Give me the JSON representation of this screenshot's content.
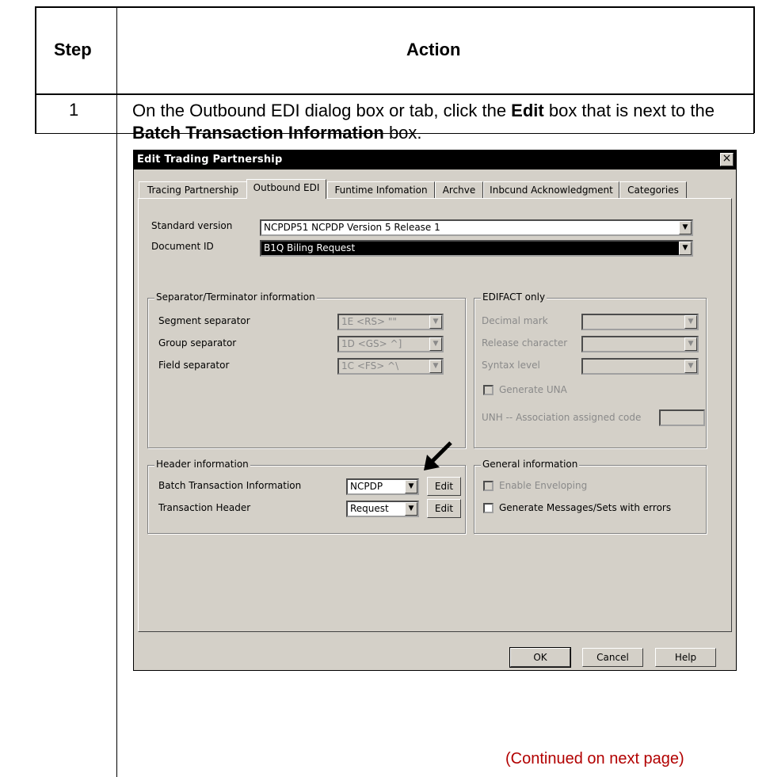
{
  "table": {
    "step_header": "Step",
    "action_header": "Action",
    "step_number": "1",
    "action_parts": [
      "On the Outbound EDI dialog box or tab, click the ",
      "Edit",
      " box that is next to the ",
      "Batch Transaction Information",
      " box."
    ],
    "continued": "(Continued on next page)"
  },
  "dialog": {
    "title": "Edit Trading Partnership",
    "close_glyph": "×",
    "tabs": [
      "Tracing Partnership",
      "Outbound EDI",
      "Funtime Infomation",
      "Archve",
      "Inbcund Acknowledgment",
      "Categories"
    ],
    "active_tab": "Outbound EDI",
    "standard_version": {
      "label": "Standard version",
      "value": "NCPDP51    NCPDP Version 5 Release 1"
    },
    "document_id": {
      "label": "Document ID",
      "value": "B1Q   Biling Request"
    },
    "separator_group": {
      "title": "Separator/Terminator information",
      "segment": {
        "label": "Segment separator",
        "value": "1E <RS> \"\""
      },
      "group": {
        "label": "Group separator",
        "value": "1D <GS> ^]"
      },
      "field": {
        "label": "Field separator",
        "value": "1C <FS> ^\\"
      }
    },
    "edifact_group": {
      "title": "EDIFACT only",
      "decimal_mark": "Decimal mark",
      "release_character": "Release character",
      "syntax_level": "Syntax level",
      "generate_una": "Generate UNA",
      "unh_code": "UNH -- Association assigned code"
    },
    "header_group": {
      "title": "Header information",
      "batch": {
        "label": "Batch Transaction Information",
        "value": "NCPDP",
        "edit": "Edit"
      },
      "transaction": {
        "label": "Transaction Header",
        "value": "Request",
        "edit": "Edit"
      }
    },
    "general_group": {
      "title": "General information",
      "enable_enveloping": "Enable Enveloping",
      "generate_messages": "Generate Messages/Sets with errors"
    },
    "buttons": {
      "ok": "OK",
      "cancel": "Cancel",
      "help": "Help"
    }
  }
}
